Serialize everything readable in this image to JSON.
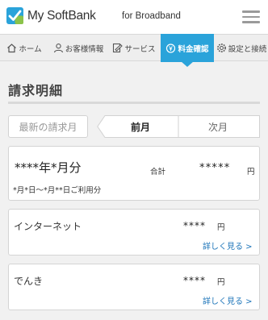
{
  "header": {
    "brand": "My SoftBank",
    "brand_sub": "for Broadband",
    "menu_icon": "hamburger-menu-icon",
    "colors": {
      "logo_blue": "#2aa3da",
      "logo_green": "#8bc34a",
      "accent": "#2aa3da"
    }
  },
  "nav": {
    "items": [
      {
        "label": "ホーム",
        "icon": "home-icon"
      },
      {
        "label": "お客様情報",
        "icon": "user-icon"
      },
      {
        "label": "サービス",
        "icon": "document-edit-icon"
      },
      {
        "label": "料金確認",
        "icon": "yen-coin-icon",
        "active": true
      },
      {
        "label": "設定と接続",
        "icon": "gear-icon"
      }
    ]
  },
  "page": {
    "title": "請求明細"
  },
  "segment": {
    "latest": "最新の請求月",
    "prev": "前月",
    "next": "次月",
    "selected": "前月"
  },
  "summary": {
    "period": "****年*月分",
    "total_label": "合計",
    "amount": "*****",
    "yen": "円",
    "dates": "*月*日～*月**日ご利用分"
  },
  "items": [
    {
      "name": "インターネット",
      "amount": "****",
      "yen": "円",
      "link": "詳しく見る >"
    },
    {
      "name": "でんき",
      "amount": "****",
      "yen": "円",
      "link": "詳しく見る >"
    }
  ]
}
